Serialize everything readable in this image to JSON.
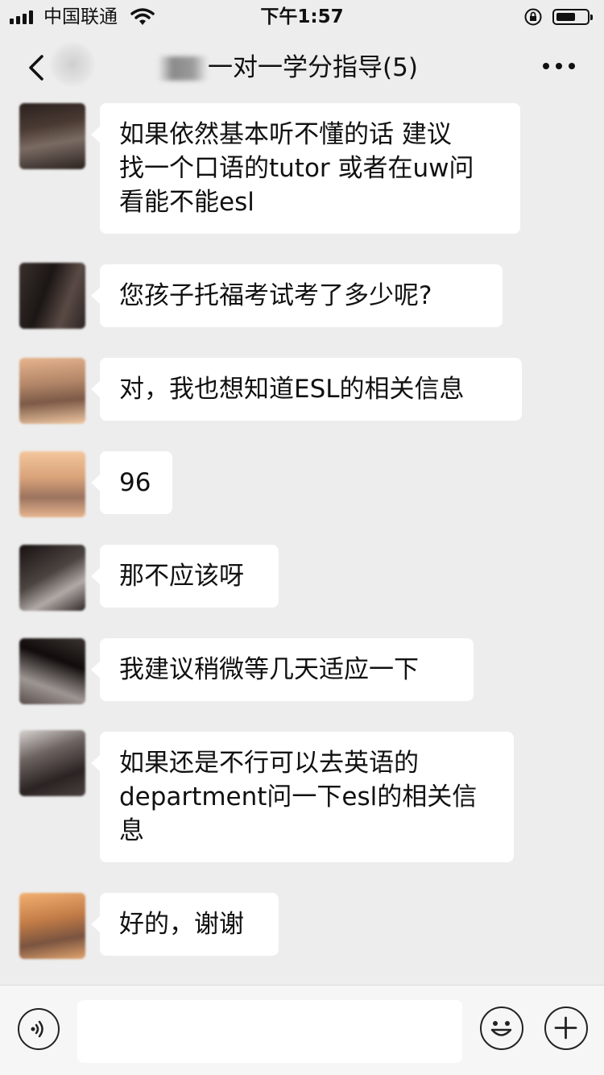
{
  "status_bar": {
    "carrier": "中国联通",
    "time": "下午1:57",
    "battery_level": 0.65,
    "icons": [
      "signal-icon",
      "wifi-icon",
      "orientation-lock-icon",
      "battery-icon"
    ]
  },
  "nav": {
    "title": "一对一学分指导(5)",
    "back_icon": "chevron-left-icon",
    "more_icon": "more-dots-icon"
  },
  "messages": [
    {
      "text": "如果依然基本听不懂的话 建议\n找一个口语的tutor 或者在uw问\n看能不能esl"
    },
    {
      "text": "您孩子托福考试考了多少呢?"
    },
    {
      "text": "对，我也想知道ESL的相关信息"
    },
    {
      "text": "96"
    },
    {
      "text": "那不应该呀"
    },
    {
      "text": "我建议稍微等几天适应一下"
    },
    {
      "text": "如果还是不行可以去英语的\ndepartment问一下esl的相关信\n息"
    },
    {
      "text": "好的，谢谢"
    }
  ],
  "input_bar": {
    "voice_icon": "voice-icon",
    "emoji_icon": "emoji-icon",
    "plus_icon": "plus-icon",
    "input_value": ""
  },
  "colors": {
    "background": "#ededed",
    "bubble": "#ffffff",
    "text": "#111111"
  }
}
